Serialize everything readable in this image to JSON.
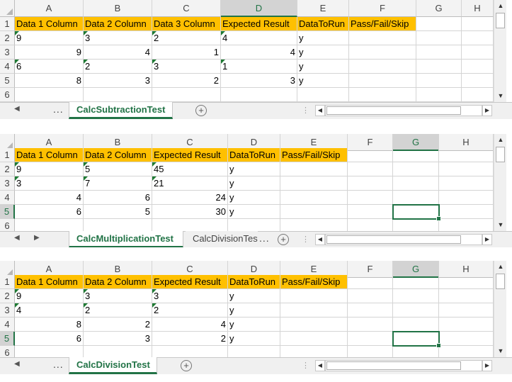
{
  "window": {
    "width": 723,
    "height": 539
  },
  "colors": {
    "header_fill": "#ffc000",
    "accent": "#217346",
    "note_triangle": "#1e7a33"
  },
  "panels": [
    {
      "columns": [
        "A",
        "B",
        "C",
        "D",
        "E",
        "F",
        "G",
        "H"
      ],
      "selected_column": "D",
      "rows": [
        "1",
        "2",
        "3",
        "4",
        "5",
        "6"
      ],
      "selected_row": "",
      "header_cells": [
        "Data 1 Column",
        "Data 2 Column",
        "Data 3 Column",
        "Expected Result",
        "DataToRun",
        "Pass/Fail/Skip"
      ],
      "data_rows": [
        [
          "9",
          "3",
          "2",
          "4",
          "y"
        ],
        [
          "9",
          "4",
          "1",
          "4",
          "y"
        ],
        [
          "6",
          "2",
          "3",
          "1",
          "y"
        ],
        [
          "8",
          "3",
          "2",
          "3",
          "y"
        ]
      ],
      "tabs": [
        {
          "label": "CalcSubtractionTest",
          "active": true
        }
      ],
      "nav": {
        "prev": "◀",
        "next": "▶",
        "more": "..."
      },
      "add_sheet": "+"
    },
    {
      "columns": [
        "A",
        "B",
        "C",
        "D",
        "E",
        "F",
        "G",
        "H"
      ],
      "selected_column": "G",
      "rows": [
        "1",
        "2",
        "3",
        "4",
        "5",
        "6"
      ],
      "selected_row": "5",
      "header_cells": [
        "Data 1 Column",
        "Data 2 Column",
        "Expected Result",
        "DataToRun",
        "Pass/Fail/Skip"
      ],
      "data_rows": [
        [
          "9",
          "5",
          "45",
          "y"
        ],
        [
          "3",
          "7",
          "21",
          "y"
        ],
        [
          "4",
          "6",
          "24",
          "y"
        ],
        [
          "6",
          "5",
          "30",
          "y"
        ]
      ],
      "tabs": [
        {
          "label": "CalcMultiplicationTest",
          "active": true
        },
        {
          "label": "CalcDivisionTest",
          "active": false
        }
      ],
      "nav": {
        "prev": "◀",
        "next": "▶",
        "more": "..."
      },
      "add_sheet": "+"
    },
    {
      "columns": [
        "A",
        "B",
        "C",
        "D",
        "E",
        "F",
        "G",
        "H"
      ],
      "selected_column": "G",
      "rows": [
        "1",
        "2",
        "3",
        "4",
        "5",
        "6"
      ],
      "selected_row": "5",
      "header_cells": [
        "Data 1 Column",
        "Data 2 Column",
        "Expected Result",
        "DataToRun",
        "Pass/Fail/Skip"
      ],
      "data_rows": [
        [
          "9",
          "3",
          "3",
          "y"
        ],
        [
          "4",
          "2",
          "2",
          "y"
        ],
        [
          "8",
          "2",
          "4",
          "y"
        ],
        [
          "6",
          "3",
          "2",
          "y"
        ]
      ],
      "tabs": [
        {
          "label": "CalcDivisionTest",
          "active": true
        }
      ],
      "nav": {
        "prev": "◀",
        "next": "▶",
        "more": "..."
      },
      "add_sheet": "+"
    }
  ]
}
